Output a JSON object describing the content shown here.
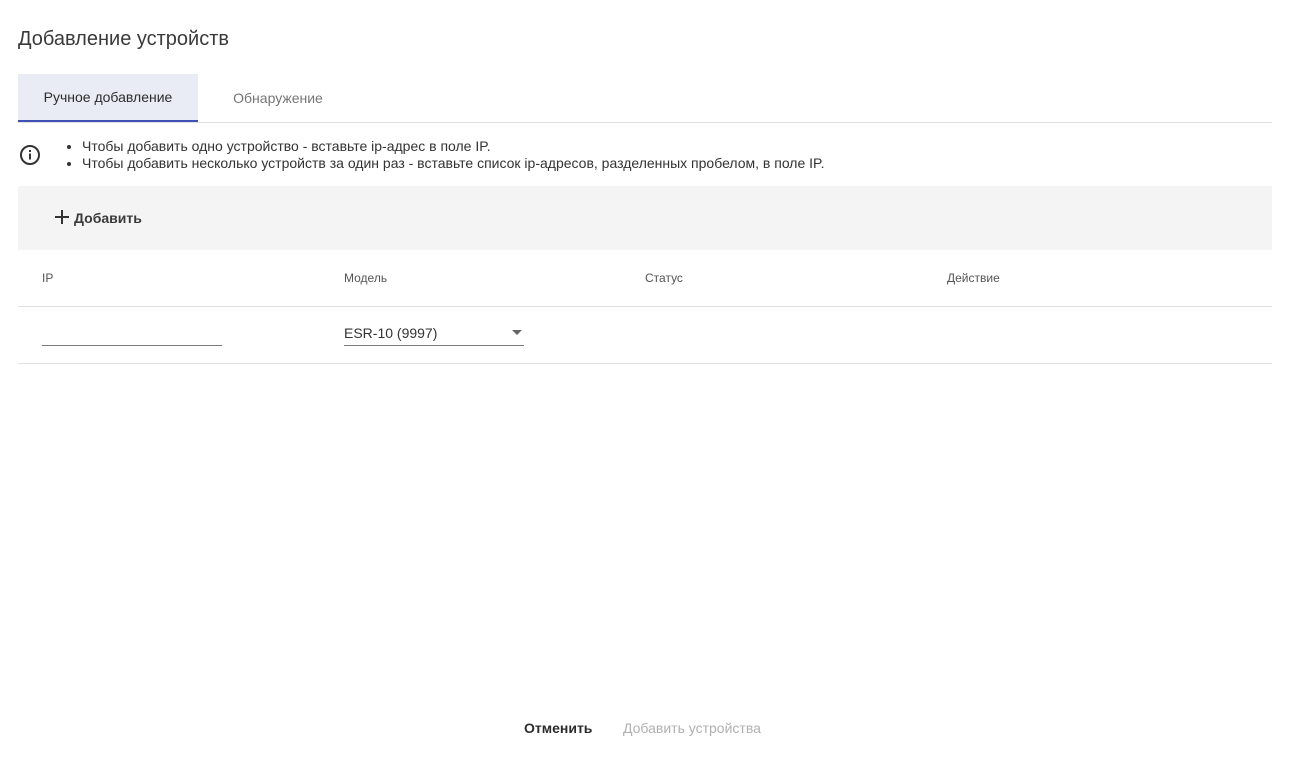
{
  "dialog": {
    "title": "Добавление устройств"
  },
  "tabs": [
    {
      "label": "Ручное добавление",
      "active": true
    },
    {
      "label": "Обнаружение",
      "active": false
    }
  ],
  "info": {
    "icon": "info-icon",
    "items": [
      "Чтобы добавить одно устройство - вставьте ip-адрес в поле IP.",
      "Чтобы добавить несколько устройств за один раз - вставьте список ip-адресов, разделенных пробелом, в поле IP."
    ]
  },
  "toolbar": {
    "add_icon": "plus-icon",
    "add_label": "Добавить"
  },
  "table": {
    "columns": [
      "IP",
      "Модель",
      "Статус",
      "Действие"
    ],
    "rows": [
      {
        "ip": "",
        "model": "ESR-10 (9997)",
        "status": "",
        "action": ""
      }
    ]
  },
  "footer": {
    "cancel_label": "Отменить",
    "submit_label": "Добавить устройства"
  },
  "colors": {
    "accent": "#3f51b5",
    "active_tab_bg": "#e9ecf5",
    "toolbar_bg": "#f4f4f4",
    "disabled_text": "#b0b0b0"
  }
}
